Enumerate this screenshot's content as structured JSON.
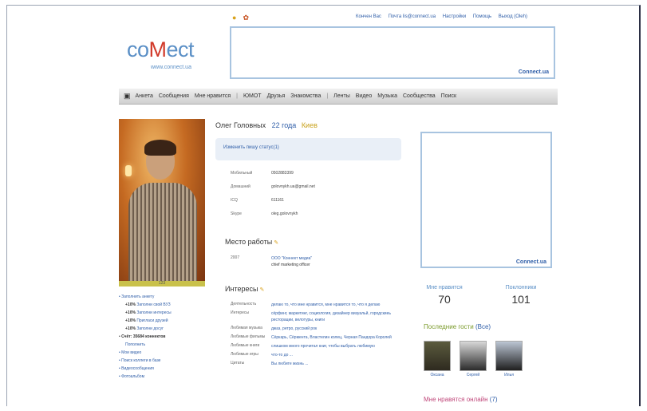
{
  "header": {
    "links": [
      "Кончен Вас",
      "Почта lis@connect.ua",
      "Настройки",
      "Помощь",
      "Выход (Oleh)"
    ],
    "logo_text_left": "co",
    "logo_text_mid": "ሻ",
    "logo_text_right": "ect",
    "logo_url": "www.connect.ua",
    "banner_tag": "Connect.ua"
  },
  "nav": {
    "items": [
      "Анкета",
      "Сообщения",
      "Мне нравится",
      "ЮМОТ",
      "Друзья",
      "Знакомства",
      "Ленты",
      "Видео",
      "Музыка",
      "Сообщества",
      "Поиск"
    ]
  },
  "profile": {
    "name": "Олег Головных",
    "age": "22 года",
    "city": "Киев",
    "status_change": "Изменить",
    "status_text": "пишу статус(1)",
    "photo_caption": "123",
    "contacts": [
      {
        "k": "Мобильный",
        "v": "0502883399"
      },
      {
        "k": "Домашний",
        "v": "golovnykh.ua@gmail.net"
      },
      {
        "k": "ICQ",
        "v": "611161"
      },
      {
        "k": "Skype",
        "v": "oleg.golovnykh"
      }
    ],
    "work_title": "Место работы",
    "work": {
      "k": "2007",
      "v1": "ООО \"Коннект медиа\"",
      "v2": "chief marketing officer"
    },
    "interests_title": "Интересы",
    "interests": [
      {
        "k": "Деятельность",
        "v": "делаю то, что мне нравится, мне нравится то, что я делаю"
      },
      {
        "k": "Интересы",
        "v": "сёрфинг, маркетинг, социология, дизайнер визуальй, городскиеь ресторации, велотуры, книги"
      },
      {
        "k": "Любимая музыка",
        "v": "джаз, ретро, русский рок"
      },
      {
        "k": "Любимые фильмы",
        "v": "Сёркарь, Сёрмента, Властелин колец, Черная Пандора Королей"
      },
      {
        "k": "Любимые книги",
        "v": "слишком много прочитал книг, чтобы выбрать любимую"
      },
      {
        "k": "Любимые игры",
        "v": "что-то до ..."
      },
      {
        "k": "Цитаты",
        "v": "Вы любите жизнь ..."
      }
    ]
  },
  "sidebar": {
    "links": [
      {
        "t": "Заполнить анкету",
        "type": "blue"
      },
      {
        "t": "+10%",
        "t2": "Заполни свой ВУЗ",
        "type": "sub"
      },
      {
        "t": "+10%",
        "t2": "Заполни интересы",
        "type": "sub"
      },
      {
        "t": "+10%",
        "t2": "Пригласи друзей",
        "type": "sub"
      },
      {
        "t": "+10%",
        "t2": "Заполни досуг",
        "type": "sub"
      },
      {
        "t": "Счёт: 35684 коннектов",
        "type": "dark"
      },
      {
        "t": "Пополнить",
        "type": "sub-plain"
      },
      {
        "t": "Мои видео",
        "type": "blue"
      },
      {
        "t": "Поиск коллеги в базе",
        "type": "blue"
      },
      {
        "t": "Видеосообщения",
        "type": "blue"
      },
      {
        "t": "Фотоальбом",
        "type": "blue"
      }
    ]
  },
  "right": {
    "banner_tag": "Connect.ua",
    "likes_label": "Мне нравится",
    "likes_value": "70",
    "fans_label": "Поклонники",
    "fans_value": "101",
    "guests_title": "Последние гости",
    "guests_all": "(Все)",
    "guests": [
      {
        "name": "Оксана"
      },
      {
        "name": "Сергей"
      },
      {
        "name": "Илья"
      }
    ],
    "online_title": "Мне нравятся онлайн",
    "online_count": "(7)"
  }
}
